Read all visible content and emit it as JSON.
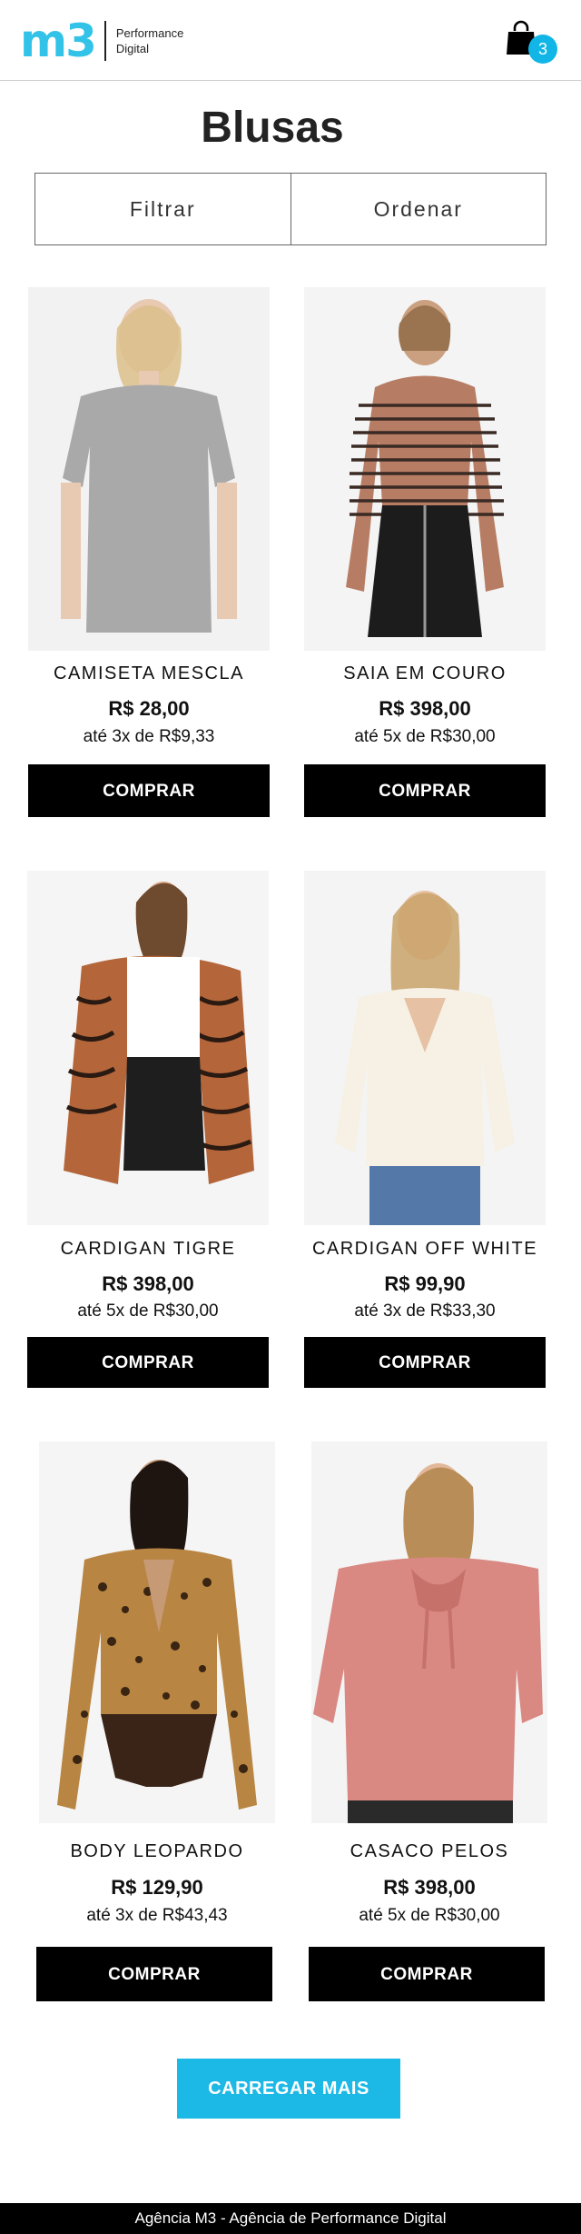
{
  "header": {
    "logo_mark": "m3",
    "logo_line1": "Performance",
    "logo_line2": "Digital",
    "cart_icon": "shopping-bag-icon",
    "cart_count": "3"
  },
  "page": {
    "title": "Blusas",
    "filter_label": "Filtrar",
    "sort_label": "Ordenar"
  },
  "products": [
    {
      "name": "CAMISETA MESCLA",
      "price": "R$ 28,00",
      "installments": "até 3x de R$9,33",
      "buy_label": "COMPRAR"
    },
    {
      "name": "SAIA EM COURO",
      "price": "R$ 398,00",
      "installments": "até 5x de R$30,00",
      "buy_label": "COMPRAR"
    },
    {
      "name": "CARDIGAN TIGRE",
      "price": "R$ 398,00",
      "installments": "até 5x de R$30,00",
      "buy_label": "COMPRAR"
    },
    {
      "name": "CARDIGAN OFF WHITE",
      "price": "R$ 99,90",
      "installments": "até 3x de R$33,30",
      "buy_label": "COMPRAR"
    },
    {
      "name": "BODY LEOPARDO",
      "price": "R$ 129,90",
      "installments": "até 3x de R$43,43",
      "buy_label": "COMPRAR"
    },
    {
      "name": "CASACO PELOS",
      "price": "R$ 398,00",
      "installments": "até 5x de R$30,00",
      "buy_label": "COMPRAR"
    }
  ],
  "load_more_label": "CARREGAR MAIS",
  "footer": {
    "text": "Agência M3 - Agência de Performance Digital"
  },
  "colors": {
    "brand": "#33c3e8",
    "accent": "#1cb8e6",
    "button": "#000000"
  }
}
